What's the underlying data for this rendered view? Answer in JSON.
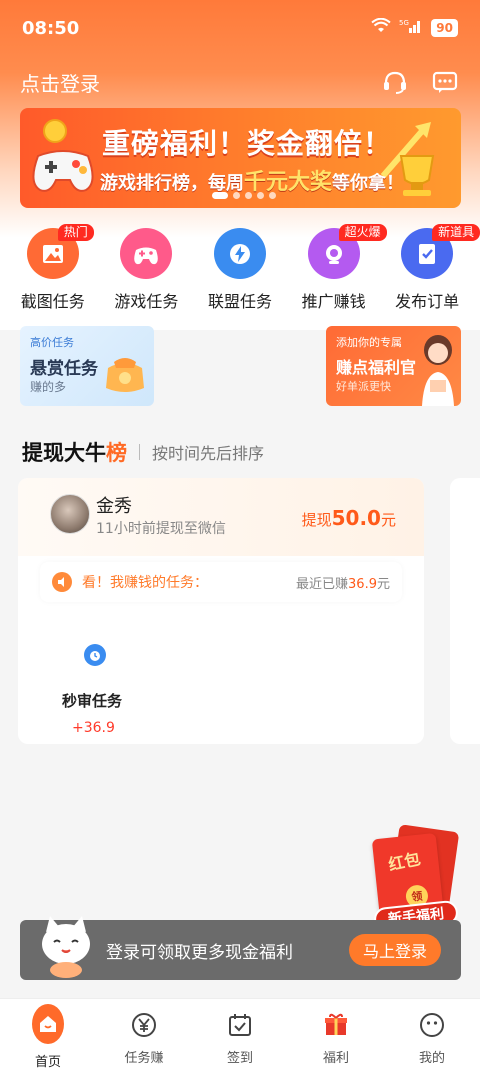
{
  "status_bar": {
    "time": "08:50",
    "network": "5G",
    "battery": "90"
  },
  "header": {
    "login_label": "点击登录"
  },
  "banner": {
    "title": "重磅福利！奖金翻倍！",
    "sub_prefix": "游戏排行榜，每周",
    "sub_highlight": "千元大奖",
    "sub_suffix": "等你拿！"
  },
  "grid": [
    {
      "label": "截图任务",
      "badge": "热门",
      "color": "#ff6a35",
      "icon": "image-icon"
    },
    {
      "label": "游戏任务",
      "badge": "",
      "color": "#ff5a8a",
      "icon": "gamepad-icon"
    },
    {
      "label": "联盟任务",
      "badge": "",
      "color": "#3a8cf0",
      "icon": "lightning-icon"
    },
    {
      "label": "推广赚钱",
      "badge": "超火爆",
      "color": "#b45af0",
      "icon": "megaphone-icon"
    },
    {
      "label": "发布订单",
      "badge": "新道具",
      "color": "#4a6af0",
      "icon": "checklist-icon"
    }
  ],
  "promo": {
    "left": {
      "tag": "高价任务",
      "title": "悬赏任务",
      "desc": "赚的多"
    },
    "right": {
      "tag": "添加你的专属",
      "title": "赚点福利官",
      "desc": "好单派更快"
    }
  },
  "rank": {
    "title_main": "提现大牛",
    "title_accent": "榜",
    "subtitle": "按时间先后排序",
    "user_name": "金秀",
    "user_desc": "11小时前提现至微信",
    "withdraw_label": "提现",
    "withdraw_amount": "50.0",
    "withdraw_unit": "元",
    "earn_label": "看！我赚钱的任务：",
    "earn_recent_prefix": "最近已赚",
    "earn_recent_amount": "36.9",
    "earn_recent_unit": "元",
    "task_name": "秒审任务",
    "task_amount": "+36.9"
  },
  "redpacket": {
    "text": "红包",
    "coin": "领",
    "ribbon": "新手福利"
  },
  "login_bar": {
    "text": "登录可领取更多现金福利",
    "button": "马上登录"
  },
  "tabs": [
    {
      "label": "首页",
      "icon": "home-icon",
      "active": true
    },
    {
      "label": "任务赚",
      "icon": "yen-coin-icon",
      "active": false
    },
    {
      "label": "签到",
      "icon": "calendar-check-icon",
      "active": false
    },
    {
      "label": "福利",
      "icon": "gift-icon",
      "active": false
    },
    {
      "label": "我的",
      "icon": "smiley-icon",
      "active": false
    }
  ]
}
